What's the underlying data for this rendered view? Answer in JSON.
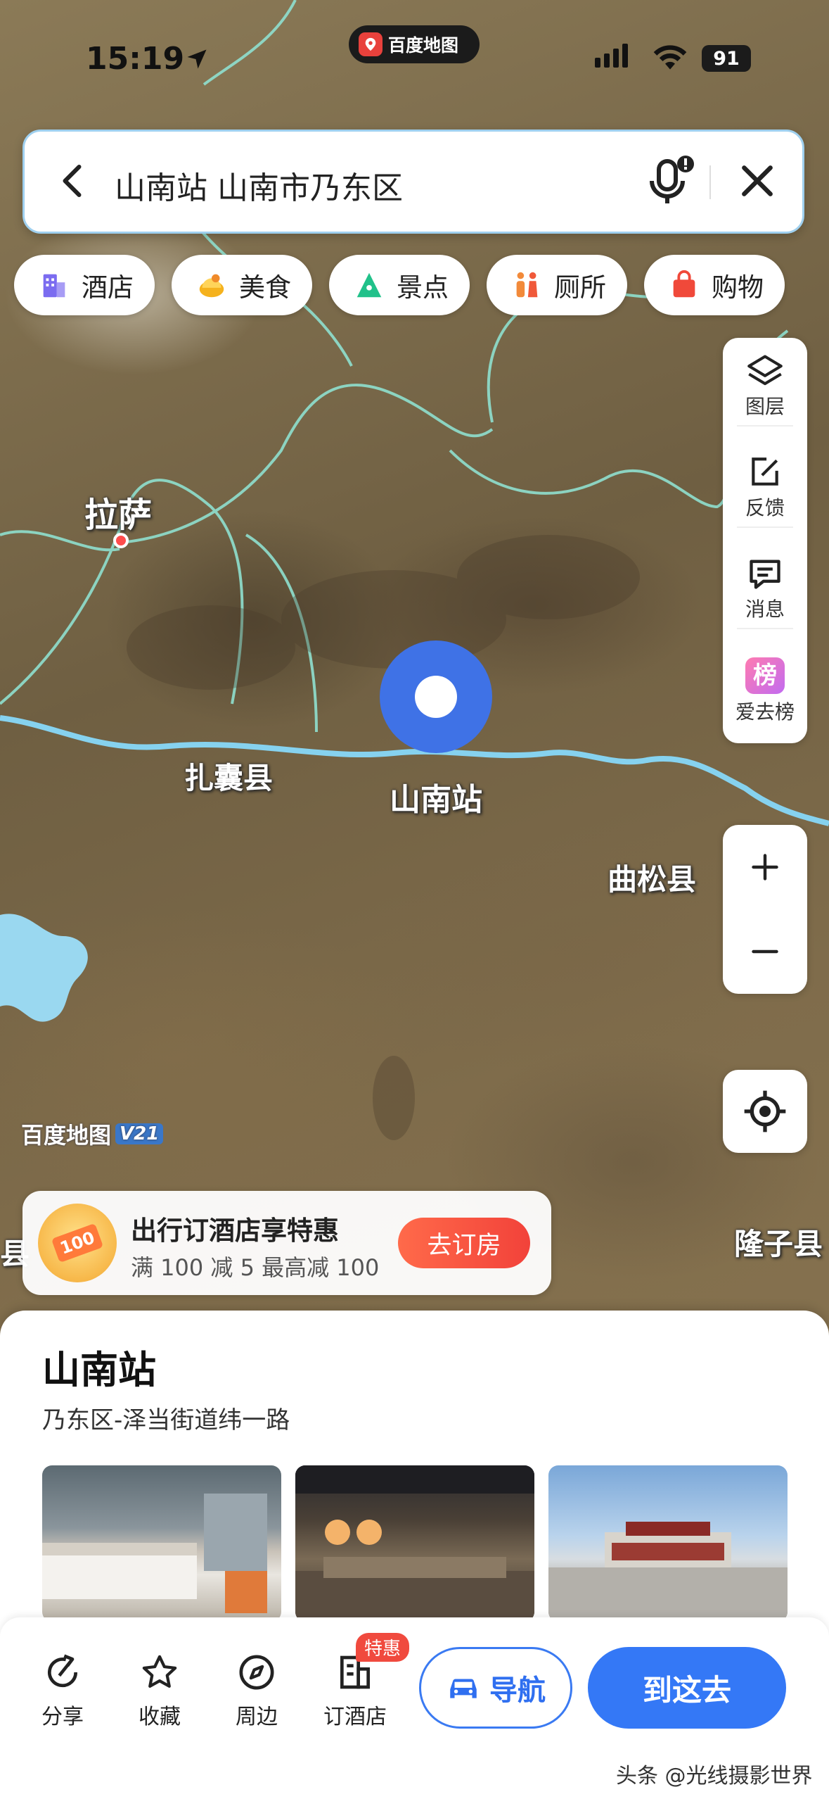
{
  "status_bar": {
    "time": "15:19",
    "app_name": "百度地图",
    "battery": "91"
  },
  "search": {
    "query": "山南站 山南市乃东区"
  },
  "categories": [
    {
      "label": "酒店",
      "icon": "hotel-icon",
      "color": "#7b6cf0"
    },
    {
      "label": "美食",
      "icon": "food-icon",
      "color": "#f5b21d"
    },
    {
      "label": "景点",
      "icon": "scenic-icon",
      "color": "#21c18a"
    },
    {
      "label": "厕所",
      "icon": "toilet-icon",
      "color": "#f28a3a"
    },
    {
      "label": "购物",
      "icon": "shopping-icon",
      "color": "#f0493a"
    }
  ],
  "tools": {
    "layers": "图层",
    "feedback": "反馈",
    "messages": "消息",
    "ranking_badge": "榜",
    "ranking": "爱去榜"
  },
  "map_labels": {
    "lhasa": "拉萨",
    "zhanang": "扎囊县",
    "pin": "山南站",
    "qusong": "曲松县",
    "longzi": "隆子县",
    "left_edge": "县"
  },
  "map_watermark": {
    "brand": "百度地图",
    "version": "V21"
  },
  "promo": {
    "badge": "100",
    "title": "出行订酒店享特惠",
    "subtitle": "满 100 减 5 最高减 100",
    "button": "去订房"
  },
  "place": {
    "name": "山南站",
    "address": "乃东区-泽当街道纬一路"
  },
  "actions": {
    "share": "分享",
    "favorite": "收藏",
    "nearby": "周边",
    "hotel": "订酒店",
    "hot_badge": "特惠",
    "navigate": "导航",
    "go_here": "到这去"
  },
  "credit": "头条 @光线摄影世界",
  "colors": {
    "accent_blue": "#3478f6",
    "promo_red": "#f2423a",
    "border_blue": "#9fd0ef"
  }
}
